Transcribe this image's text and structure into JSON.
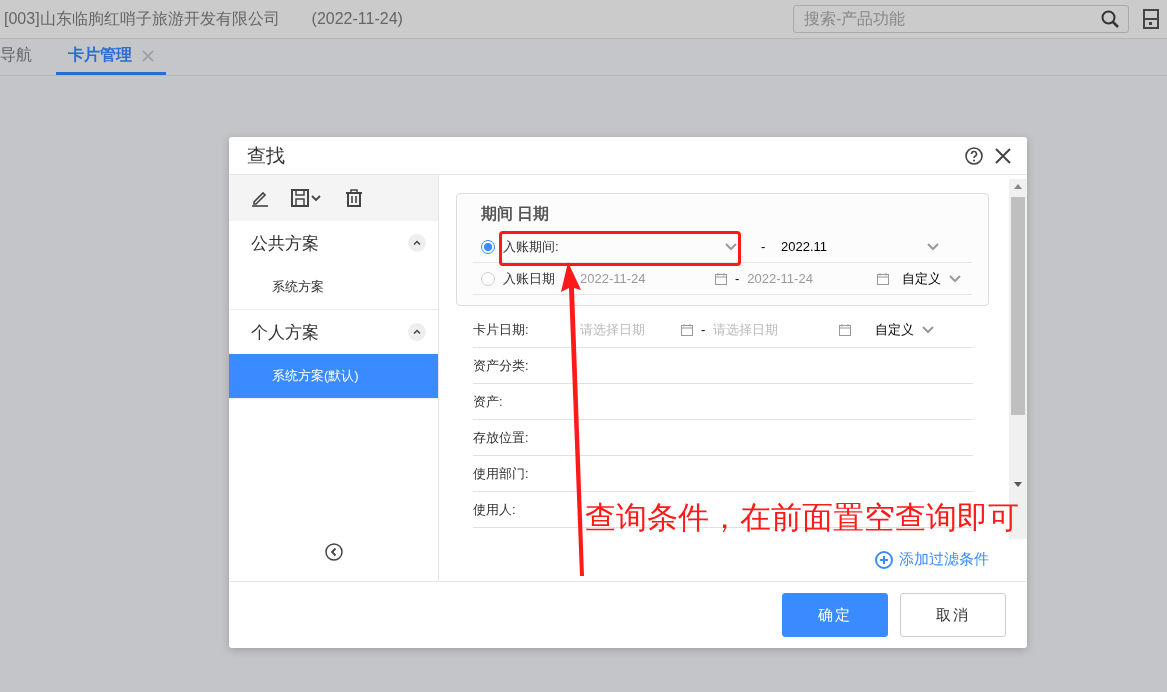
{
  "header": {
    "company": "[003]山东临朐红哨子旅游开发有限公司",
    "date": "(2022-11-24)",
    "search": {
      "placeholder": "搜索-产品功能"
    }
  },
  "tabs": [
    {
      "label": "导航",
      "selected": false,
      "closable": false
    },
    {
      "label": "卡片管理",
      "selected": true,
      "closable": true
    }
  ],
  "dialog": {
    "title": "查找",
    "scheme_groups": [
      {
        "title": "公共方案",
        "expanded": true,
        "items": [
          {
            "label": "系统方案",
            "selected": false
          }
        ]
      },
      {
        "title": "个人方案",
        "expanded": true,
        "items": [
          {
            "label": "系统方案(默认)",
            "selected": true
          }
        ]
      }
    ],
    "period_group": {
      "title": "期间 日期",
      "options": [
        {
          "kind": "period",
          "selected": true,
          "label": "入账期间:",
          "separator": "-",
          "to": "2022.11"
        },
        {
          "kind": "date",
          "selected": false,
          "label": "入账日期",
          "from": "2022-11-24",
          "separator": "-",
          "to": "2022-11-24",
          "mode": "自定义"
        }
      ]
    },
    "filters": [
      {
        "kind": "date",
        "label": "卡片日期:",
        "from_placeholder": "请选择日期",
        "separator": "-",
        "to_placeholder": "请选择日期",
        "mode": "自定义"
      },
      {
        "kind": "text",
        "label": "资产分类:"
      },
      {
        "kind": "text",
        "label": "资产:"
      },
      {
        "kind": "text",
        "label": "存放位置:"
      },
      {
        "kind": "text",
        "label": "使用部门:"
      },
      {
        "kind": "text",
        "label": "使用人:"
      }
    ],
    "add_filter": "添加过滤条件",
    "buttons": [
      {
        "label": "确定",
        "kind": "primary"
      },
      {
        "label": "取消",
        "kind": "secondary"
      }
    ]
  },
  "annotation": {
    "text": "查询条件，在前面置空查询即可"
  }
}
